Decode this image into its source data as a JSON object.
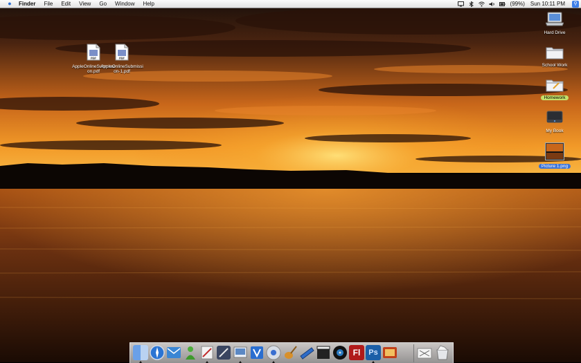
{
  "menubar": {
    "apple": "",
    "items": [
      "Finder",
      "File",
      "Edit",
      "View",
      "Go",
      "Window",
      "Help"
    ],
    "battery": "(99%)",
    "clock": "Sun 10:11 PM",
    "spotlight_icon": "magnifier-icon"
  },
  "desktop_icons": {
    "pdf1": "AppleOnlineSubmissi on.pdf",
    "pdf2": "AppleOnlineSubmissi on-1.pdf",
    "hard_drive": "Hard Drive",
    "school_work": "School Work",
    "homework": "Homework",
    "my_book": "My Book",
    "picture": "Picture 1.png"
  },
  "colors": {
    "selection": "#3c74d8",
    "label_green": "#c4e06a"
  },
  "dock": {
    "apps": [
      "finder-icon",
      "safari-icon",
      "mail-icon",
      "ichat-icon",
      "text-editor-icon",
      "pencil-app-icon",
      "preview-icon",
      "dictionary-icon",
      "itunes-icon",
      "garageband-icon",
      "sidebar-app-icon",
      "final-cut-icon",
      "dvd-player-icon",
      "flash-icon",
      "photoshop-icon",
      "photo-booth-icon",
      "mail-box-icon",
      "trash-icon"
    ],
    "flash_label": "Fl",
    "photoshop_label": "Ps"
  }
}
